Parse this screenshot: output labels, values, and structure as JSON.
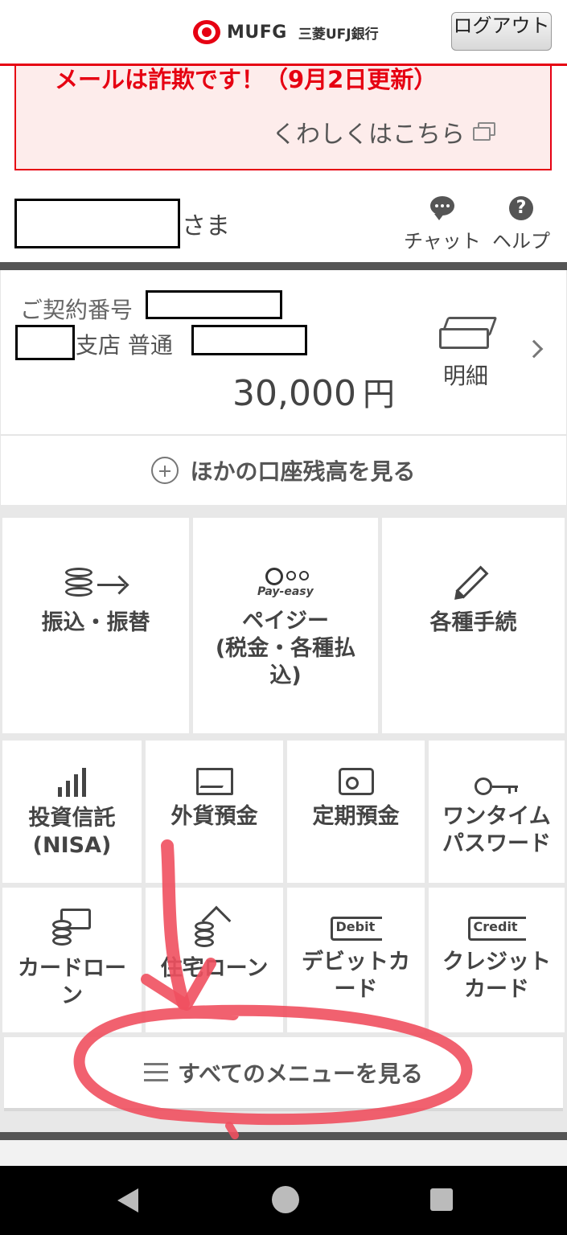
{
  "header": {
    "logo_text": "MUFG",
    "bank_name": "三菱UFJ銀行",
    "logout_label": "ログアウト"
  },
  "alert": {
    "title": "メールは詐欺です！（9月2日更新）",
    "link_label": "くわしくはこちら"
  },
  "greeting": {
    "suffix": "さま",
    "chat_label": "チャット",
    "help_label": "ヘルプ"
  },
  "account": {
    "contract_label": "ご契約番号",
    "branch_label": "支店 普通",
    "balance": "30,000",
    "currency": "円",
    "detail_label": "明細"
  },
  "other_accounts_label": "ほかの口座残高を見る",
  "menu": {
    "transfer": "振込・振替",
    "payeasy_line1": "ペイジー",
    "payeasy_line2": "(税金・各種払",
    "payeasy_line3": "込)",
    "payeasy_logo": "Pay-easy",
    "procedures": "各種手続",
    "investment_line1": "投資信託",
    "investment_line2": "(NISA)",
    "fx_deposit": "外貨預金",
    "time_deposit": "定期預金",
    "otp_line1": "ワンタイム",
    "otp_line2": "パスワード",
    "card_loan_line1": "カードロー",
    "card_loan_line2": "ン",
    "home_loan": "住宅ローン",
    "debit_line1": "デビットカ",
    "debit_line2": "ード",
    "debit_badge": "Debit",
    "credit_line1": "クレジット",
    "credit_line2": "カード",
    "credit_badge": "Credit"
  },
  "all_menu_label": "すべてのメニューを見る",
  "colors": {
    "brand_red": "#e60012",
    "annotation_red": "#f0505f"
  }
}
